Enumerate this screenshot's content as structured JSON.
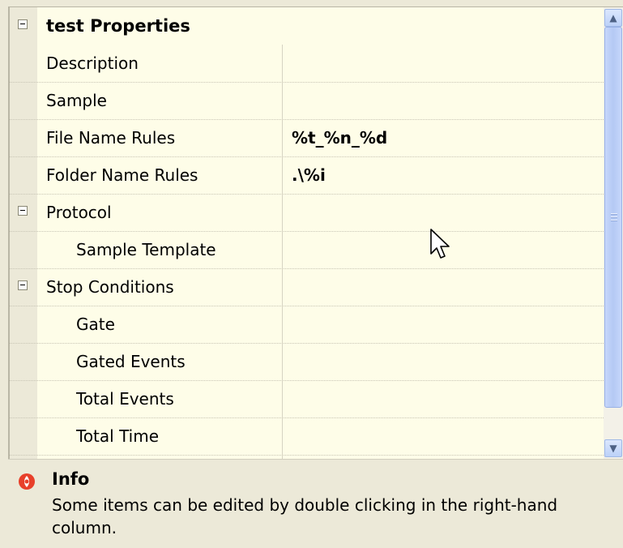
{
  "grid": {
    "category": "test Properties",
    "rows": [
      {
        "name": "Description",
        "value": ""
      },
      {
        "name": "Sample",
        "value": ""
      },
      {
        "name": "File Name Rules",
        "value": "%t_%n_%d"
      },
      {
        "name": "Folder Name Rules",
        "value": ".\\%i"
      },
      {
        "name": "Protocol",
        "value": ""
      },
      {
        "name": "Sample Template",
        "value": ""
      },
      {
        "name": "Stop Conditions",
        "value": ""
      },
      {
        "name": "Gate",
        "value": ""
      },
      {
        "name": "Gated Events",
        "value": ""
      },
      {
        "name": "Total Events",
        "value": ""
      },
      {
        "name": "Total Time",
        "value": ""
      }
    ]
  },
  "scrollbar": {
    "up_arrow": "▲",
    "down_arrow": "▼"
  },
  "info": {
    "title": "Info",
    "text": "Some items can be edited by double clicking in the right-hand column."
  },
  "colors": {
    "grid_background": "#fefde8",
    "window_background": "#ece9d8",
    "info_icon": "#e8402a"
  }
}
